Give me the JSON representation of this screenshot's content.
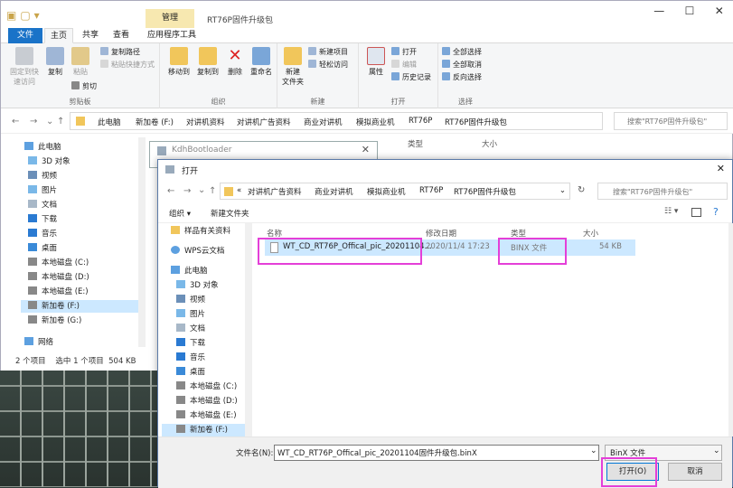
{
  "explorer": {
    "ctx_tab": "管理",
    "title": "RT76P固件升级包",
    "tabs": [
      "文件",
      "主页",
      "共享",
      "查看",
      "应用程序工具"
    ],
    "ribbon": {
      "pin": "固定到快\n速访问",
      "copy": "复制",
      "paste": "粘贴",
      "copy_path": "复制路径",
      "paste_shortcut": "粘贴快捷方式",
      "cut": "剪切",
      "clipboard": "剪贴板",
      "move_to": "移动到",
      "copy_to": "复制到",
      "delete": "删除",
      "rename": "重命名",
      "organize": "组织",
      "new_folder": "新建\n文件夹",
      "new_item": "新建项目",
      "easy_access": "轻松访问",
      "new": "新建",
      "properties": "属性",
      "open": "打开",
      "edit": "编辑",
      "history": "历史记录",
      "open_group": "打开",
      "select_all": "全部选择",
      "select_none": "全部取消",
      "invert": "反向选择",
      "select": "选择"
    },
    "breadcrumbs": [
      "此电脑",
      "新加卷 (F:)",
      "对讲机资料",
      "对讲机广告资料",
      "商业对讲机",
      "模拟商业机",
      "RT76P",
      "RT76P固件升级包"
    ],
    "search_placeholder": "搜索\"RT76P固件升级包\"",
    "tree": [
      "此电脑",
      "3D 对象",
      "视频",
      "图片",
      "文档",
      "下载",
      "音乐",
      "桌面",
      "本地磁盘 (C:)",
      "本地磁盘 (D:)",
      "本地磁盘 (E:)",
      "新加卷 (F:)",
      "新加卷 (G:)",
      "网络"
    ],
    "col_type": "类型",
    "col_size": "大小",
    "status": "2 个项目    选中 1 个项目  504 KB"
  },
  "kdh": {
    "title": "KdhBootloader"
  },
  "dialog": {
    "title": "打开",
    "breadcrumbs": [
      "«",
      "对讲机广告资料",
      "商业对讲机",
      "模拟商业机",
      "RT76P",
      "RT76P固件升级包"
    ],
    "search_placeholder": "搜索\"RT76P固件升级包\"",
    "organize": "组织 ▾",
    "new_folder": "新建文件夹",
    "nav": [
      "样品有关资料",
      "WPS云文档",
      "此电脑",
      "3D 对象",
      "视频",
      "图片",
      "文档",
      "下载",
      "音乐",
      "桌面",
      "本地磁盘 (C:)",
      "本地磁盘 (D:)",
      "本地磁盘 (E:)",
      "新加卷 (F:)"
    ],
    "headers": {
      "name": "名称",
      "date": "修改日期",
      "type": "类型",
      "size": "大小"
    },
    "file": {
      "name": "WT_CD_RT76P_Offical_pic_20201104...",
      "date": "2020/11/4 17:23",
      "type": "BINX 文件",
      "size": "54 KB"
    },
    "filename_label": "文件名(N):",
    "filename_value": "WT_CD_RT76P_Offical_pic_20201104固件升级包.binX",
    "filetype_value": "BinX 文件",
    "open_button": "打开(O)",
    "cancel_button": "取消"
  },
  "colors": {
    "accent": "#1a73c8",
    "highlight": "#e43fd8",
    "selected_row": "#cce8ff",
    "context_tab": "#f7e8b0"
  }
}
